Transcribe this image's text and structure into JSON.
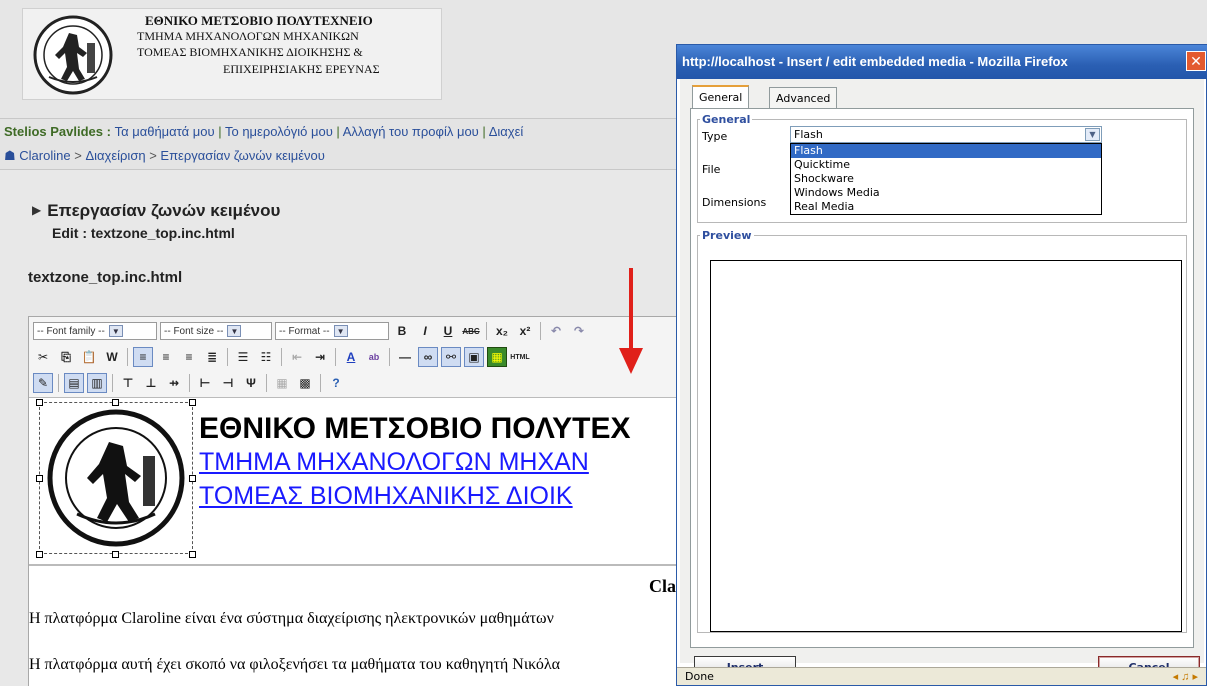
{
  "banner": {
    "line1": "ΕΘΝΙΚΟ ΜΕΤΣΟΒΙΟ ΠΟΛΥΤΕΧΝΕΙΟ",
    "line2": "ΤΜΗΜΑ ΜΗΧΑΝΟΛΟΓΩΝ ΜΗΧΑΝΙΚΩΝ",
    "line3": "ΤΟΜΕΑΣ ΒΙΟΜΗΧΑΝΙΚΗΣ ΔΙΟΙΚΗΣΗΣ &",
    "line4": "ΕΠΙΧΕΙΡΗΣΙΑΚΗΣ ΕΡΕΥΝΑΣ"
  },
  "userbar": {
    "user": "Stelios Pavlides :",
    "links": [
      "Τα μαθήματά μου",
      "Το ημερολόγιό μου",
      "Αλλαγή του προφίλ μου",
      "Διαχεί"
    ]
  },
  "breadcrumb": [
    "Claroline",
    "Διαχείριση",
    "Επεργασίαν ζωνών κειμένου"
  ],
  "content": {
    "tool_title": "Επεργασίαν ζωνών κειμένου",
    "tool_subtitle": "Edit : textzone_top.inc.html",
    "file_title": "textzone_top.inc.html"
  },
  "editor": {
    "font_family": "-- Font family --",
    "font_size": "-- Font size --",
    "format": "-- Format --",
    "doc": {
      "heading1": "ΕΘΝΙΚΟ ΜΕΤΣΟΒΙΟ ΠΟΛΥΤΕΧ",
      "heading2": "ΤΜΗΜΑ ΜΗΧΑΝΟΛΟΓΩΝ ΜΗΧΑΝ",
      "heading3": "ΤΟΜΕΑΣ ΒΙΟΜΗΧΑΝΙΚΗΣ ΔΙΟΙΚ",
      "cla": "Cla",
      "para1": "Η πλατφόρμα Claroline είναι ένα σύστημα διαχείρισης ηλεκτρονικών μαθημάτων",
      "para2": "Η πλατφόρμα αυτή έχει σκοπό να φιλοξενήσει τα μαθήματα του καθηγητή Νικόλα"
    }
  },
  "popup": {
    "title": "http://localhost - Insert / edit embedded media - Mozilla Firefox",
    "tabs": [
      "General",
      "Advanced"
    ],
    "general_legend": "General",
    "preview_legend": "Preview",
    "labels": {
      "type": "Type",
      "file": "File",
      "dimensions": "Dimensions"
    },
    "type_selected": "Flash",
    "type_options": [
      "Flash",
      "Quicktime",
      "Shockware",
      "Windows Media",
      "Real Media"
    ],
    "insert_label": "Insert",
    "cancel_label": "Cancel",
    "status": "Done"
  },
  "colors": {
    "titlebar": "#2a5fb3",
    "link": "#2a4f9a",
    "user": "#3f6b26",
    "selected_option": "#316ac5",
    "arrow": "#e0201a"
  }
}
